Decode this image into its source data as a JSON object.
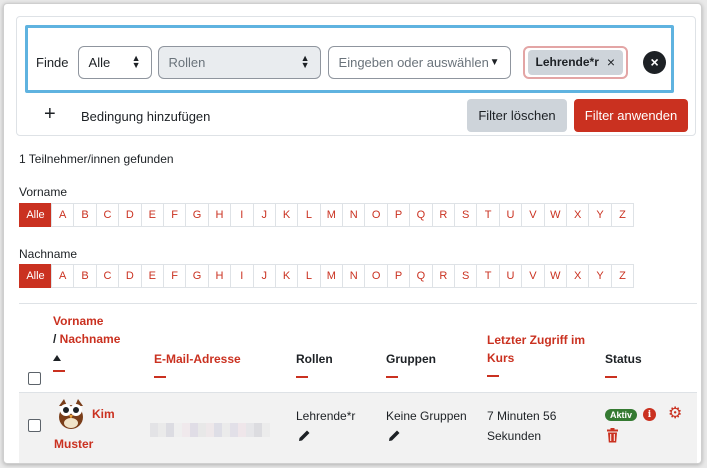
{
  "filter": {
    "finde_label": "Finde",
    "match_select": "Alle",
    "type_select": "Rollen",
    "value_placeholder": "Eingeben oder auswählen...",
    "selected_badge": "Lehrende*r",
    "badge_remove": "×",
    "remove_condition": "×",
    "add_condition_icon": "+",
    "add_condition": "Bedingung hinzufügen",
    "clear_button": "Filter löschen",
    "apply_button": "Filter anwenden"
  },
  "result": {
    "found_text": "1 Teilnehmer/innen gefunden"
  },
  "initials": {
    "firstname_label": "Vorname",
    "lastname_label": "Nachname",
    "all_label": "Alle",
    "letters": [
      "A",
      "B",
      "C",
      "D",
      "E",
      "F",
      "G",
      "H",
      "I",
      "J",
      "K",
      "L",
      "M",
      "N",
      "O",
      "P",
      "Q",
      "R",
      "S",
      "T",
      "U",
      "V",
      "W",
      "X",
      "Y",
      "Z"
    ]
  },
  "table": {
    "headers": {
      "firstname": "Vorname",
      "slash": "/ ",
      "lastname": "Nachname",
      "email": "E-Mail-Adresse",
      "roles": "Rollen",
      "groups": "Gruppen",
      "last_access": "Letzter Zugriff im Kurs",
      "status": "Status"
    },
    "rows": [
      {
        "name_first": "Kim",
        "name_last": "Muster",
        "role": "Lehrende*r",
        "groups": "Keine Gruppen",
        "last_access": "7 Minuten 56 Sekunden",
        "status": "Aktiv"
      }
    ]
  },
  "colors": {
    "accent": "#ca3120",
    "active_green": "#357a32",
    "highlight": "#5fb3e0"
  }
}
